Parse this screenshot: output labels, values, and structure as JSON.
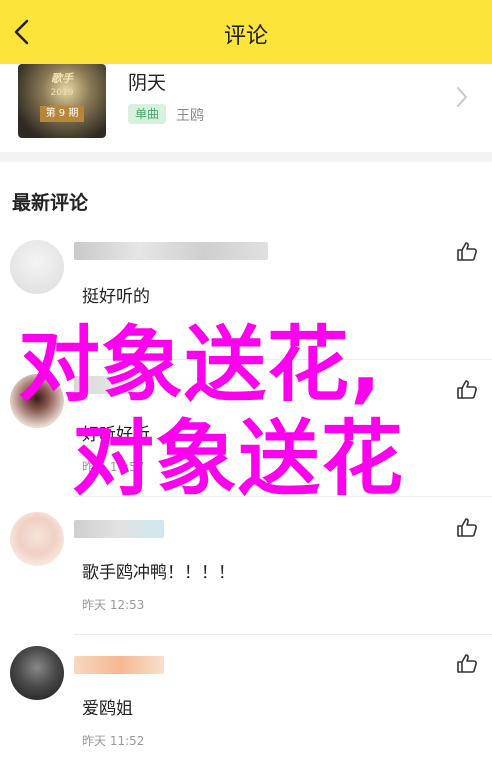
{
  "header": {
    "title": "评论",
    "back_icon": "chevron-left-icon",
    "background": "#fde43a"
  },
  "song": {
    "cover_logo": "歌手",
    "cover_year": "2019",
    "cover_episode": "第 9 期",
    "title": "阴天",
    "tag": "单曲",
    "artist": "王鸥"
  },
  "section": {
    "title": "最新评论"
  },
  "comments": [
    {
      "text": "挺好听的",
      "time": "",
      "like_icon": "thumbs-up-icon"
    },
    {
      "text": "好听好听",
      "time": "昨天 17:57",
      "like_icon": "thumbs-up-icon"
    },
    {
      "text": "歌手鸥冲鸭！！！！",
      "time": "昨天 12:53",
      "like_icon": "thumbs-up-icon"
    },
    {
      "text": "爱鸥姐",
      "time": "昨天 11:52",
      "like_icon": "thumbs-up-icon"
    }
  ],
  "overlay": {
    "line1": "对象送花,",
    "line2": "对象送花",
    "color": "#ff00ee"
  }
}
